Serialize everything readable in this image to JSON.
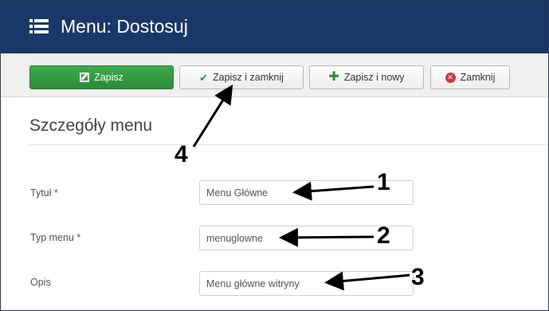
{
  "header": {
    "title": "Menu: Dostosuj",
    "icon": "list-icon"
  },
  "toolbar": {
    "save_label": "Zapisz",
    "save_close_label": "Zapisz i zamknij",
    "save_new_label": "Zapisz i nowy",
    "close_label": "Zamknij"
  },
  "section": {
    "title": "Szczegóły menu"
  },
  "form": {
    "title_label": "Tytuł *",
    "title_value": "Menu Główne",
    "type_label": "Typ menu *",
    "type_value": "menuglowne",
    "desc_label": "Opis",
    "desc_value": "Menu główne witryny"
  },
  "annotations": [
    "1",
    "2",
    "3",
    "4"
  ],
  "colors": {
    "header_bg": "#1a3867",
    "primary_green": "#2f8a3b",
    "close_red": "#c83a3a"
  }
}
